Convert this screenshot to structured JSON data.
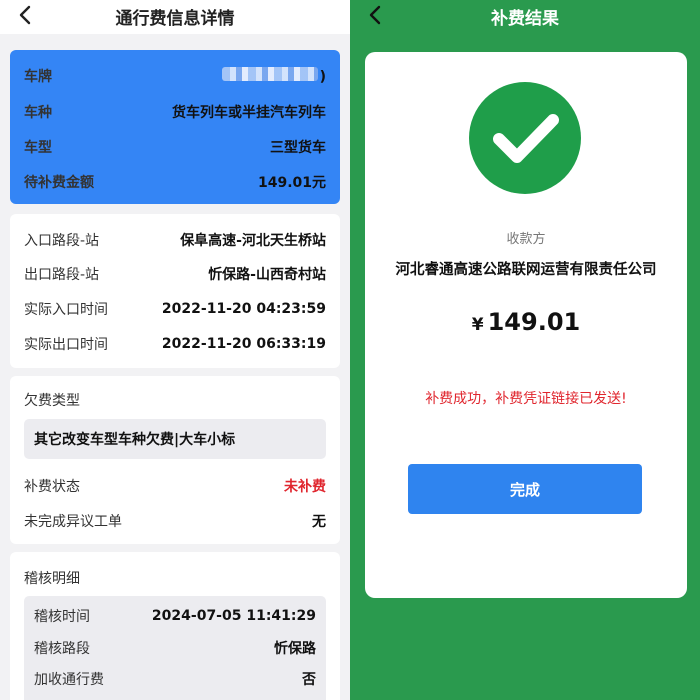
{
  "left_screen": {
    "nav_title": "通行费信息详情",
    "vehicle": {
      "plate_label": "车牌",
      "plate_suffix": ")",
      "vehicle_class_label": "车种",
      "vehicle_class": "货车列车或半挂汽车列车",
      "vehicle_type_label": "车型",
      "vehicle_type": "三型货车",
      "amount_due_label": "待补费金额",
      "amount_due": "149.01元"
    },
    "route": {
      "entry_label": "入口路段-站",
      "entry_value": "保阜高速-河北天生桥站",
      "exit_label": "出口路段-站",
      "exit_value": "忻保路-山西奇村站",
      "entry_time_label": "实际入口时间",
      "entry_time": "2022-11-20 04:23:59",
      "exit_time_label": "实际出口时间",
      "exit_time": "2022-11-20 06:33:19"
    },
    "debt": {
      "type_label": "欠费类型",
      "type_value": "其它改变车型车种欠费|大车小标",
      "status_label": "补费状态",
      "status_value": "未补费",
      "dispute_label": "未完成异议工单",
      "dispute_value": "无"
    },
    "audit": {
      "title": "稽核明细",
      "time_label": "稽核时间",
      "time_value": "2024-07-05 11:41:29",
      "section_label": "稽核路段",
      "section_value": "忻保路",
      "surcharge_label": "加收通行费",
      "surcharge_value": "否"
    }
  },
  "right_screen": {
    "nav_title": "补费结果",
    "payee_label": "收款方",
    "payee_name": "河北睿通高速公路联网运营有限责任公司",
    "currency_symbol": "¥",
    "amount": "149.01",
    "success_message": "补费成功，补费凭证链接已发送!",
    "done_button": "完成"
  },
  "colors": {
    "blue_card": "#3485f5",
    "green_background": "#2a9a4e",
    "check_circle": "#1f9e4a",
    "button_blue": "#2f84ef",
    "alert_red": "#e0262e"
  },
  "icons": {
    "back": "chevron-left-icon",
    "success": "check-circle-icon"
  }
}
